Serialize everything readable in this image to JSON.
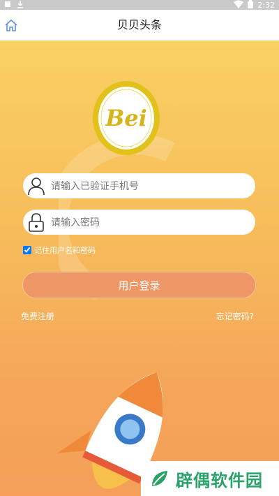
{
  "status_bar": {
    "time": "2:32"
  },
  "app_bar": {
    "title": "贝贝头条"
  },
  "logo": {
    "text": "Bei"
  },
  "login": {
    "phone_placeholder": "请输入已验证手机号",
    "password_placeholder": "请输入密码",
    "remember_label": "记住用户名和密码",
    "remember_checked": true,
    "submit_label": "用户登录",
    "register_link": "免费注册",
    "forgot_link": "忘记密码?"
  },
  "watermark": {
    "text": "辟偶软件园"
  },
  "colors": {
    "accent": "#ee9666",
    "background_top": "#f9d064",
    "background_bottom": "#f59f58",
    "logo_ring": "#e2c21a"
  }
}
